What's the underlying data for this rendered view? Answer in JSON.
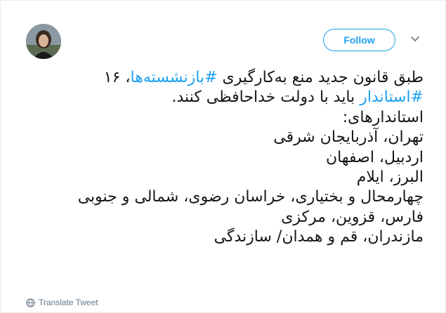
{
  "tweet": {
    "follow_label": "Follow",
    "lines": [
      {
        "pre": "طبق قانون جدید منع به‌کارگیری ",
        "tag": "#بازنشسته‌ها",
        "post": "، ۱۶"
      },
      {
        "pre": "",
        "tag": "#استاندار",
        "post": " باید با دولت خداحافظی کنند."
      },
      {
        "text": "استاندارهای:"
      },
      {
        "text": "تهران، آذربایجان شرقی"
      },
      {
        "text": "اردبیل، اصفهان"
      },
      {
        "text": "البرز، ایلام"
      },
      {
        "text": "چهارمحال و بختیاری، خراسان رضوی، شمالی و جنوبی"
      },
      {
        "text": "فارس، قزوین، مرکزی"
      },
      {
        "text": "مازندران، قم و همدان/ سازندگی"
      }
    ],
    "translate_label": "Translate Tweet"
  },
  "icons": {
    "chevron": "chevron-down-icon",
    "globe": "globe-icon"
  },
  "colors": {
    "accent": "#1da1f2",
    "text": "#14171a",
    "muted": "#657786",
    "border": "#e6ecf0"
  }
}
